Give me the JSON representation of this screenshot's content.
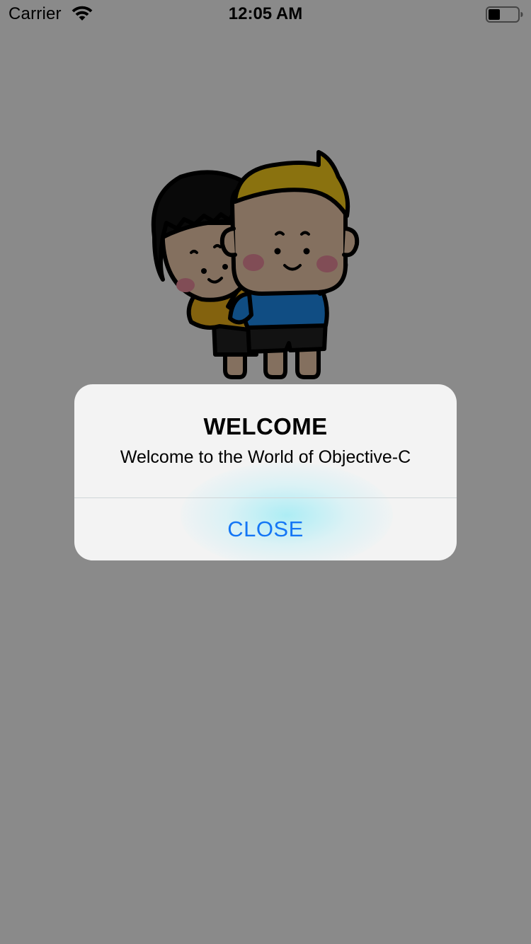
{
  "status_bar": {
    "carrier": "Carrier",
    "time": "12:05 AM",
    "wifi_icon": "wifi-icon",
    "battery_icon": "battery-icon",
    "battery_level_fraction": 0.4
  },
  "content": {
    "illustration": "cartoon-couple-illustration"
  },
  "alert": {
    "title": "WELCOME",
    "message": "Welcome to the World of Objective-C",
    "button_label": "CLOSE",
    "button_color": "#1476f5"
  },
  "colors": {
    "overlay": "#898989",
    "alert_background": "#f7f7f7"
  }
}
